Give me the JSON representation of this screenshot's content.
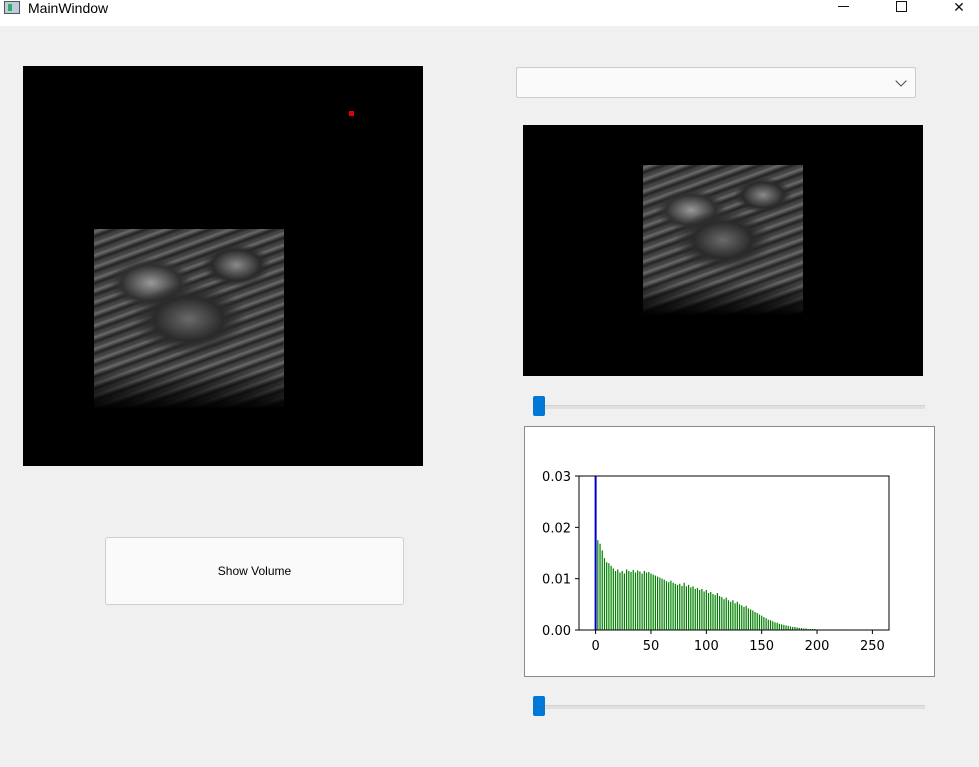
{
  "window": {
    "title": "MainWindow",
    "minimize_icon": "minimize-icon",
    "maximize_icon": "maximize-icon",
    "close_glyph": "✕"
  },
  "dropdown": {
    "selected": ""
  },
  "buttons": {
    "show_volume": "Show Volume"
  },
  "sliders": {
    "slice_slider_value": 0,
    "threshold_slider_value": 0
  },
  "colors": {
    "accent": "#0078d7",
    "marker": "#e00000",
    "hist_bars": "#008000",
    "threshold_line": "#0000cc"
  },
  "chart_data": {
    "type": "bar",
    "title": "",
    "xlabel": "",
    "ylabel": "",
    "xlim": [
      -15,
      265
    ],
    "ylim": [
      0,
      0.03
    ],
    "xticks": [
      0,
      50,
      100,
      150,
      200,
      250
    ],
    "yticks": [
      0.0,
      0.01,
      0.02,
      0.03
    ],
    "ytick_labels": [
      "0.00",
      "0.01",
      "0.02",
      "0.03"
    ],
    "threshold_line_x": 0,
    "x": [
      0,
      2,
      4,
      6,
      8,
      10,
      12,
      14,
      16,
      18,
      20,
      22,
      24,
      26,
      28,
      30,
      32,
      34,
      36,
      38,
      40,
      42,
      44,
      46,
      48,
      50,
      52,
      54,
      56,
      58,
      60,
      62,
      64,
      66,
      68,
      70,
      72,
      74,
      76,
      78,
      80,
      82,
      84,
      86,
      88,
      90,
      92,
      94,
      96,
      98,
      100,
      102,
      104,
      106,
      108,
      110,
      112,
      114,
      116,
      118,
      120,
      122,
      124,
      126,
      128,
      130,
      132,
      134,
      136,
      138,
      140,
      142,
      144,
      146,
      148,
      150,
      152,
      154,
      156,
      158,
      160,
      162,
      164,
      166,
      168,
      170,
      172,
      174,
      176,
      178,
      180,
      182,
      184,
      186,
      188,
      190,
      192,
      194,
      196,
      198,
      200,
      202,
      204,
      206,
      208,
      210,
      212,
      214,
      216,
      218,
      220,
      222,
      224,
      226,
      228,
      230
    ],
    "values": [
      0.0185,
      0.0175,
      0.0168,
      0.0155,
      0.014,
      0.0132,
      0.013,
      0.0125,
      0.012,
      0.0115,
      0.0118,
      0.0112,
      0.0115,
      0.011,
      0.0118,
      0.0115,
      0.0113,
      0.0117,
      0.0112,
      0.0116,
      0.0114,
      0.011,
      0.0115,
      0.0112,
      0.0113,
      0.011,
      0.0108,
      0.0106,
      0.0104,
      0.0102,
      0.01,
      0.0098,
      0.0095,
      0.0093,
      0.0096,
      0.0092,
      0.009,
      0.0088,
      0.009,
      0.0086,
      0.0092,
      0.0085,
      0.0088,
      0.0083,
      0.0085,
      0.008,
      0.0082,
      0.0078,
      0.008,
      0.0075,
      0.0078,
      0.0072,
      0.0074,
      0.007,
      0.0068,
      0.0072,
      0.0066,
      0.0064,
      0.006,
      0.0063,
      0.0058,
      0.0055,
      0.0058,
      0.0052,
      0.0055,
      0.005,
      0.0048,
      0.0045,
      0.0047,
      0.0042,
      0.004,
      0.0038,
      0.0035,
      0.0033,
      0.003,
      0.0028,
      0.0025,
      0.0023,
      0.002,
      0.0019,
      0.0017,
      0.0015,
      0.0014,
      0.0012,
      0.0011,
      0.001,
      0.0009,
      0.0008,
      0.0007,
      0.0006,
      0.0006,
      0.0005,
      0.0004,
      0.0004,
      0.0003,
      0.0003,
      0.0002,
      0.0002,
      0.0002,
      0.0002,
      0.0001,
      0.0001,
      0.0001,
      0.0001,
      0.0001,
      0.0001,
      0.0001,
      0.0001,
      0.0001,
      0.0001,
      0.0001,
      0.0001,
      0.0001,
      0.0001,
      0.0001,
      0.0001
    ]
  }
}
